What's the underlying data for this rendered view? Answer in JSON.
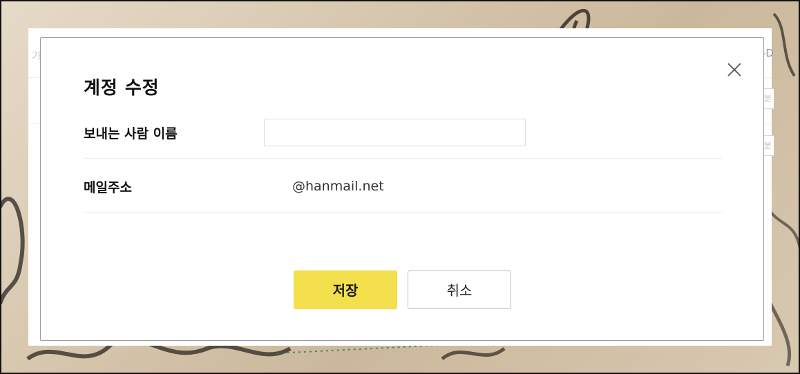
{
  "dialog": {
    "title": "계정 수정",
    "close_icon": "close-icon",
    "sender_name": {
      "label": "보내는 사람 이름",
      "value": "",
      "placeholder": ""
    },
    "email": {
      "label": "메일주소",
      "value": "@hanmail.net"
    },
    "buttons": {
      "save": "저장",
      "cancel": "취소"
    },
    "colors": {
      "save_button": "#f4e04d",
      "cancel_border": "#bdbdbd"
    }
  }
}
